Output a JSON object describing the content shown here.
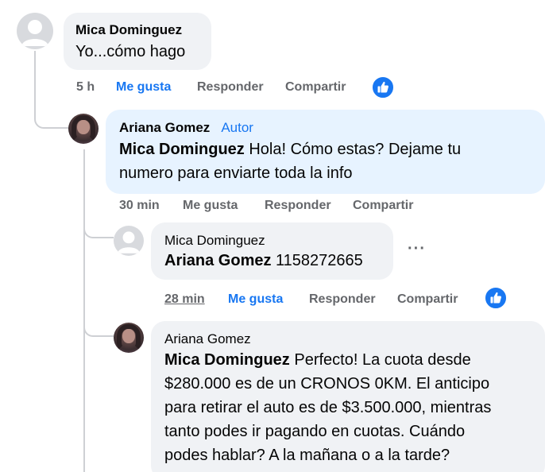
{
  "comment1": {
    "author": "Mica Dominguez",
    "text": "Yo...cómo hago",
    "time": "5 h",
    "like_label": "Me gusta",
    "reply_label": "Responder",
    "share_label": "Compartir"
  },
  "comment2": {
    "author": "Ariana Gomez",
    "author_tag": "Autor",
    "mention": "Mica Dominguez",
    "text_line1": " Hola! Cómo estas? Dejame tu",
    "text_line2": "numero para enviarte toda la info",
    "time": "30 min",
    "like_label": "Me gusta",
    "reply_label": "Responder",
    "share_label": "Compartir"
  },
  "comment3": {
    "author": "Mica Dominguez",
    "mention": "Ariana Gomez",
    "text": " 1158272665",
    "more": "···",
    "time": "28 min",
    "like_label": "Me gusta",
    "reply_label": "Responder",
    "share_label": "Compartir"
  },
  "comment4": {
    "author": "Ariana Gomez",
    "mention": "Mica Dominguez",
    "text_line1": " Perfecto! La cuota desde",
    "text_line2": "$280.000 es de un CRONOS 0KM. El anticipo",
    "text_line3": "para retirar el auto es de $3.500.000, mientras",
    "text_line4": "tanto podes ir pagando en cuotas. Cuándo",
    "text_line5": "podes hablar? A la mañana o a la tarde?"
  },
  "colors": {
    "accent": "#1877f2",
    "bubble": "#f0f2f5",
    "author_bubble": "#e7f3ff",
    "meta_text": "#65676b"
  }
}
